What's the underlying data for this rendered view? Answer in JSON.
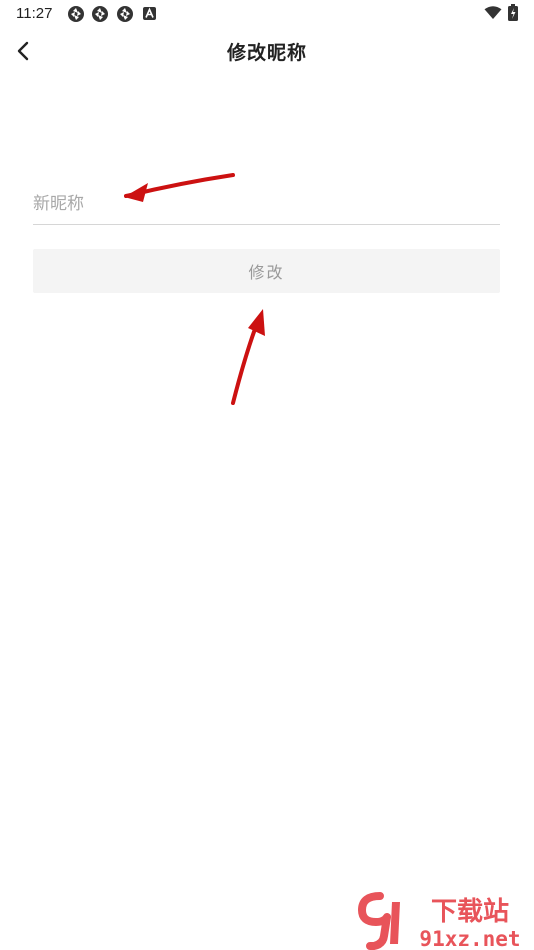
{
  "status_bar": {
    "time": "11:27",
    "left_icons": [
      "aperture-icon",
      "aperture-icon",
      "aperture-icon",
      "a-badge-icon"
    ],
    "right_icons": [
      "wifi-icon",
      "battery-icon"
    ]
  },
  "header": {
    "title": "修改昵称",
    "back_icon": "chevron-left-icon"
  },
  "form": {
    "nickname_placeholder": "新昵称",
    "nickname_value": "",
    "submit_label": "修改"
  },
  "colors": {
    "annotation_arrow": "#cc1111",
    "button_bg": "#f4f4f4",
    "button_text": "#999999",
    "underline": "#d6d6d6"
  },
  "watermark": {
    "logo_text": "9",
    "brand_text": "下载站",
    "domain_text": "91xz.net"
  }
}
